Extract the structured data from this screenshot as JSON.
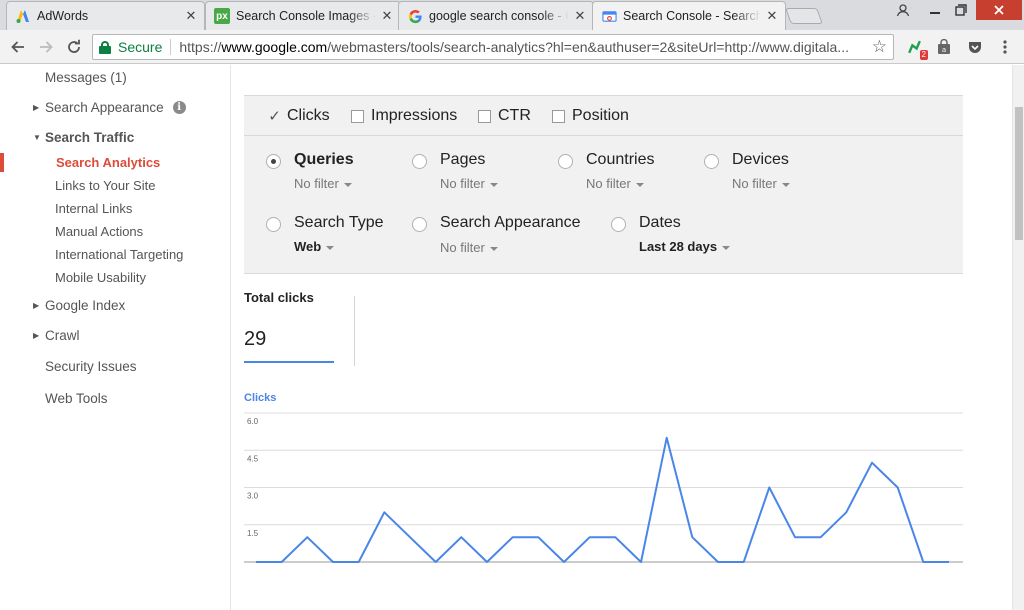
{
  "browser": {
    "tabs": [
      {
        "title": "AdWords",
        "favicon": "adwords-logo-icon"
      },
      {
        "title": "Search Console Images - Fr",
        "favicon": "pixabay-logo-icon"
      },
      {
        "title": "google search console - Go",
        "favicon": "google-g-icon"
      },
      {
        "title": "Search Console - Search An",
        "favicon": "search-console-icon",
        "active": true
      }
    ],
    "secure_label": "Secure",
    "url_prefix": "https://",
    "url_domain": "www.google.com",
    "url_path": "/webmasters/tools/search-analytics?hl=en&authuser=2&siteUrl=http://www.digitala...",
    "extension_badge": "2"
  },
  "sidebar": {
    "messages": "Messages (1)",
    "search_appearance": "Search Appearance",
    "search_traffic": "Search Traffic",
    "sub_items": [
      "Search Analytics",
      "Links to Your Site",
      "Internal Links",
      "Manual Actions",
      "International Targeting",
      "Mobile Usability"
    ],
    "google_index": "Google Index",
    "crawl": "Crawl",
    "security_issues": "Security Issues",
    "web_tools": "Web Tools"
  },
  "metrics": {
    "clicks": {
      "label": "Clicks",
      "checked": true
    },
    "impressions": {
      "label": "Impressions",
      "checked": false
    },
    "ctr": {
      "label": "CTR",
      "checked": false
    },
    "position": {
      "label": "Position",
      "checked": false
    }
  },
  "dimensions": {
    "queries": {
      "label": "Queries",
      "filter": "No filter"
    },
    "pages": {
      "label": "Pages",
      "filter": "No filter"
    },
    "countries": {
      "label": "Countries",
      "filter": "No filter"
    },
    "devices": {
      "label": "Devices",
      "filter": "No filter"
    },
    "search_type": {
      "label": "Search Type",
      "filter": "Web"
    },
    "search_appearance": {
      "label": "Search Appearance",
      "filter": "No filter"
    },
    "dates": {
      "label": "Dates",
      "filter": "Last 28 days"
    }
  },
  "total_clicks": {
    "label": "Total clicks",
    "value": "29"
  },
  "colors": {
    "accent": "#4a86e8",
    "active_nav": "#dd4b39"
  },
  "chart_data": {
    "type": "line",
    "series": [
      {
        "name": "Clicks",
        "values": [
          0,
          0,
          1,
          0,
          0,
          2,
          1,
          0,
          1,
          0,
          1,
          1,
          0,
          1,
          1,
          0,
          5,
          1,
          0,
          0,
          3,
          1,
          1,
          2,
          4,
          3,
          0,
          0
        ]
      }
    ],
    "ylim": [
      0,
      6
    ],
    "yticks": [
      "6.0",
      "4.5",
      "3.0",
      "1.5"
    ],
    "grid": true,
    "legend": "top-left"
  }
}
